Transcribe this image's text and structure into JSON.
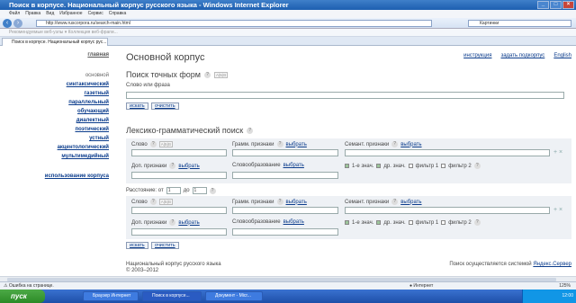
{
  "window": {
    "title": "Поиск в корпусе. Национальный корпус русского языка - Windows Internet Explorer"
  },
  "menu": [
    "Файл",
    "Правка",
    "Вид",
    "Избранное",
    "Сервис",
    "Справка"
  ],
  "address": {
    "url": "http://www.ruscorpora.ru/search-main.html",
    "search_placeholder": "Картинки"
  },
  "favorites": {
    "items": "Рекомендуемые веб-узлы ▾  Коллекция веб-фрагм..."
  },
  "tab": {
    "label": "Поиск в корпусе. Национальный корпус рус..."
  },
  "sidebar": {
    "home": "главная",
    "items": [
      "основной",
      "синтаксический",
      "газетный",
      "параллельный",
      "обучающий",
      "диалектный",
      "поэтический",
      "устный",
      "акцентологический",
      "мультимедийный"
    ],
    "usage": "использование корпуса"
  },
  "main": {
    "title": "Основной корпус",
    "links": [
      "инструкция",
      "задать подкорпус",
      "English"
    ],
    "exact": {
      "heading": "Поиск точных форм",
      "field_label": "Слово или фраза",
      "search_btn": "искать",
      "clear_btn": "очистить"
    },
    "lexgram": {
      "heading": "Лексико-грамматический поиск",
      "word": "Слово",
      "gram": "Грамм. признаки",
      "sem": "Семант. признаки",
      "choose": "выбрать",
      "addit": "Доп. признаки",
      "wordform": "Словообразование",
      "chk1": "1-е знач.",
      "chk2": "др. знач.",
      "chk3": "фильтр 1",
      "chk4": "фильтр 2",
      "distance": "Расстояние: от",
      "dist_from": "1",
      "dist_to_label": "до",
      "dist_to": "1",
      "search_btn": "искать",
      "clear_btn": "очистить"
    },
    "footer": {
      "left1": "Национальный корпус русского языка",
      "left2": "© 2003–2012",
      "right_text": "Поиск осуществляется системой",
      "right_link": "Яндекс.Сервер"
    }
  },
  "statusbar": {
    "left": "Ошибка на странице.",
    "zone": "Интернет",
    "zoom": "125%"
  },
  "taskbar": {
    "start": "пуск",
    "tasks": [
      "Браузер Интернет",
      "Поиск в корпусе...",
      "Документ - Micr..."
    ],
    "clock": "12:00"
  }
}
